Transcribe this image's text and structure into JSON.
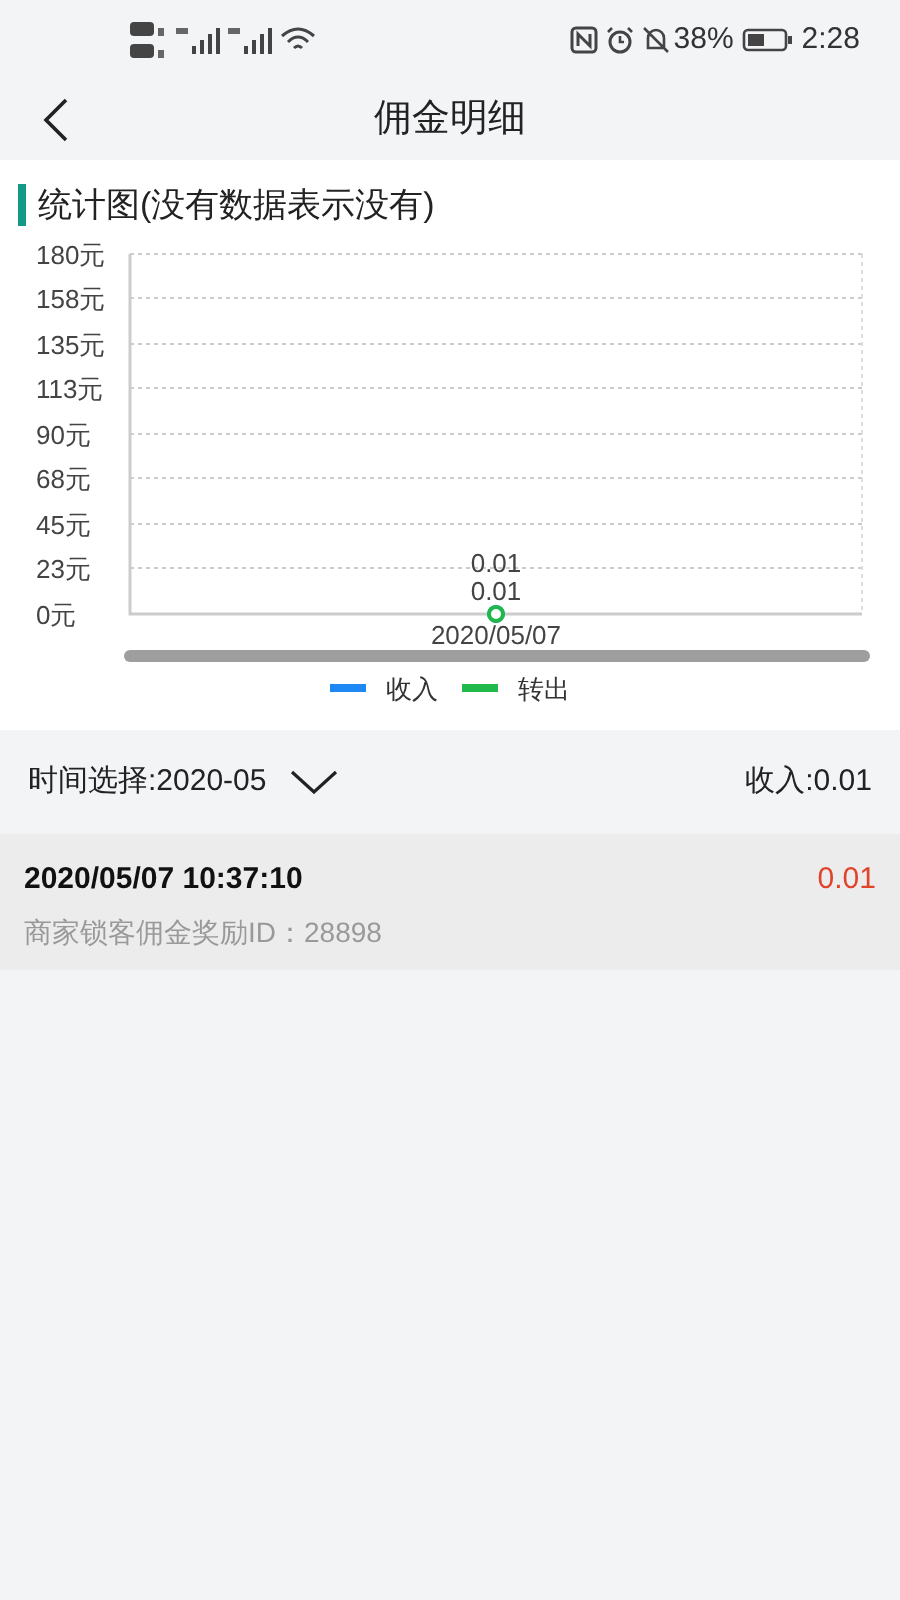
{
  "status_bar": {
    "battery": "38%",
    "time": "2:28"
  },
  "header": {
    "title": "佣金明细"
  },
  "chart_section": {
    "title": "统计图(没有数据表示没有)",
    "chart_data": {
      "type": "line",
      "categories": [
        "2020/05/07"
      ],
      "ylim": [
        0,
        180
      ],
      "yticks": [
        {
          "value": 0,
          "label": "0元"
        },
        {
          "value": 23,
          "label": "23元"
        },
        {
          "value": 45,
          "label": "45元"
        },
        {
          "value": 68,
          "label": "68元"
        },
        {
          "value": 90,
          "label": "90元"
        },
        {
          "value": 113,
          "label": "113元"
        },
        {
          "value": 135,
          "label": "135元"
        },
        {
          "value": 158,
          "label": "158元"
        },
        {
          "value": 180,
          "label": "180元"
        }
      ],
      "grid": true,
      "series": [
        {
          "name": "收入",
          "color": "#1e88f5",
          "values": [
            0.01
          ],
          "marker": true
        },
        {
          "name": "转出",
          "color": "#1fb84a",
          "values": [
            0.01
          ],
          "marker": true
        }
      ],
      "data_labels": true
    }
  },
  "filter": {
    "label": "时间选择:2020-05",
    "total": "收入:0.01"
  },
  "records": [
    {
      "time": "2020/05/07 10:37:10",
      "amount": "0.01",
      "description": "商家锁客佣金奖励ID：28898"
    }
  ]
}
